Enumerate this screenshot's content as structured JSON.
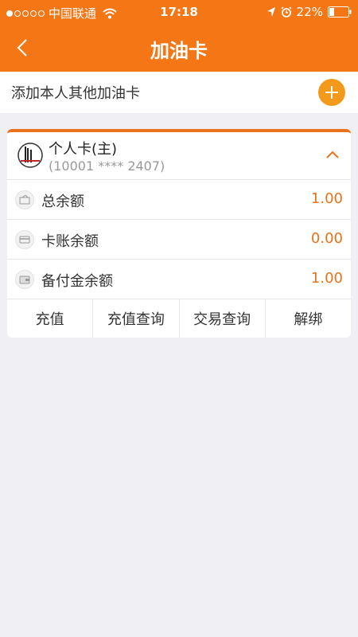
{
  "status_bar": {
    "carrier": "中国联通",
    "time": "17:18",
    "battery": "22%"
  },
  "nav": {
    "title": "加油卡"
  },
  "add_card": {
    "label": "添加本人其他加油卡"
  },
  "card": {
    "name": "个人卡(主)",
    "number": "(10001 **** 2407)",
    "rows": [
      {
        "label": "总余额",
        "value": "1.00",
        "icon": "balance-icon"
      },
      {
        "label": "卡账余额",
        "value": "0.00",
        "icon": "card-account-icon"
      },
      {
        "label": "备付金余额",
        "value": "1.00",
        "icon": "wallet-icon"
      }
    ],
    "actions": [
      {
        "label": "充值"
      },
      {
        "label": "充值查询"
      },
      {
        "label": "交易查询"
      },
      {
        "label": "解绑"
      }
    ]
  },
  "colors": {
    "header": "#f47615",
    "accent": "#e8731b",
    "add_button": "#f39a1b",
    "background": "#efeff4"
  }
}
